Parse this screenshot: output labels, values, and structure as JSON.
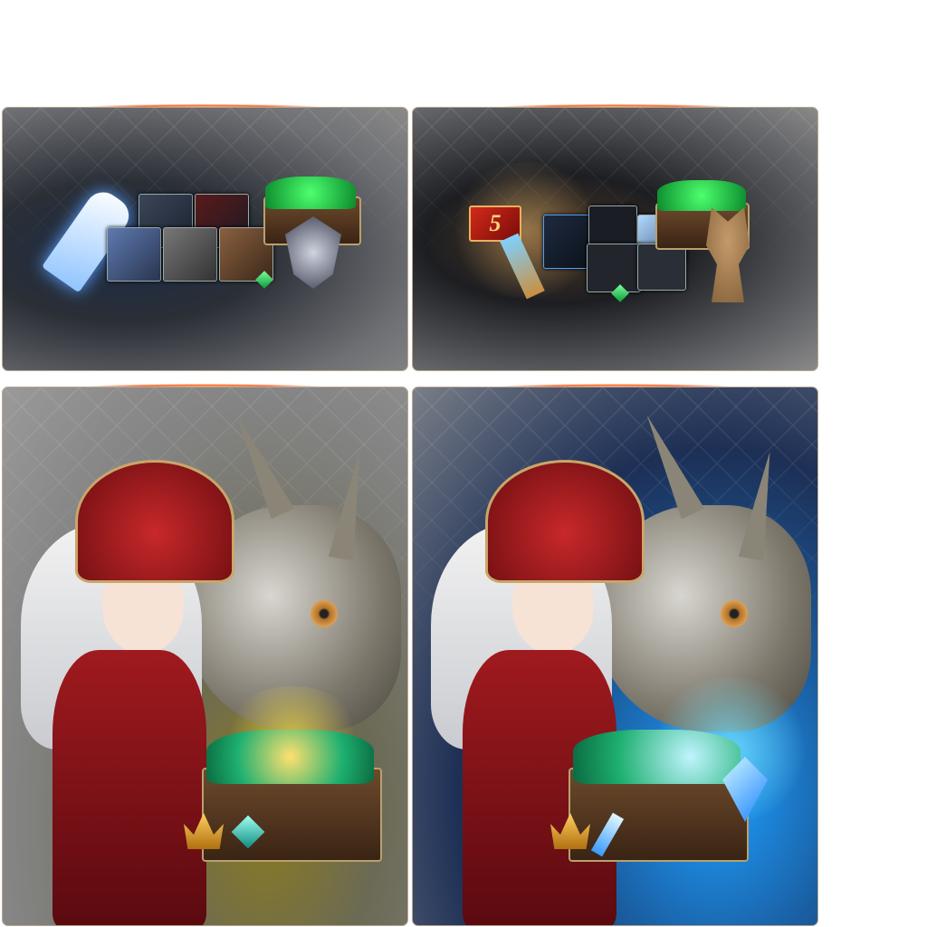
{
  "packages": [
    {
      "name": "hero-key-package"
    },
    {
      "name": "ticket-materials-package",
      "badge": "5"
    },
    {
      "name": "character-dragon-package-gold"
    },
    {
      "name": "character-dragon-package-blue"
    }
  ],
  "colors": {
    "accent_glow": "#ff6a30",
    "border": "#b8a890",
    "gem_green": "#0a9a3a",
    "badge_red": "#d22a1a"
  }
}
